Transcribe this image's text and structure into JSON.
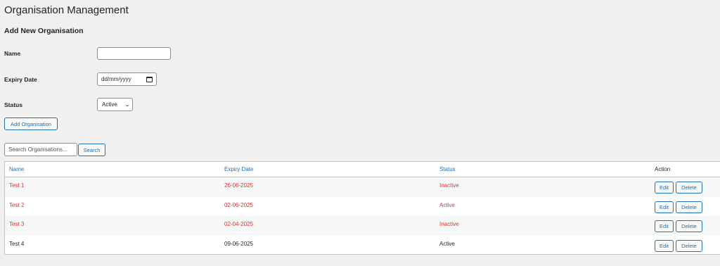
{
  "page_title": "Organisation Management",
  "form": {
    "section_title": "Add New Organisation",
    "name_label": "Name",
    "name_value": "",
    "expiry_label": "Expiry Date",
    "expiry_placeholder": "dd/mm/yyyy",
    "status_label": "Status",
    "status_value": "Active",
    "add_button": "Add Organisation"
  },
  "search": {
    "placeholder": "Search Organisations...",
    "button": "Search"
  },
  "table": {
    "columns": [
      "Name",
      "Expiry Date",
      "Status",
      "Action"
    ],
    "rows": [
      {
        "name": "Test 1",
        "expiry": "26-06-2025",
        "status": "Inactive",
        "edit": "Edit",
        "delete": "Delete"
      },
      {
        "name": "Test 2",
        "expiry": "02-06-2025",
        "status": "Active",
        "edit": "Edit",
        "delete": "Delete"
      },
      {
        "name": "Test 3",
        "expiry": "02-04-2025",
        "status": "Inactive",
        "edit": "Edit",
        "delete": "Delete"
      },
      {
        "name": "Test 4",
        "expiry": "09-06-2025",
        "status": "Active",
        "edit": "Edit",
        "delete": "Delete"
      }
    ]
  },
  "colors": {
    "accent": "#2271b1",
    "expired_text": "#d63638",
    "background": "#f0f0f1"
  }
}
